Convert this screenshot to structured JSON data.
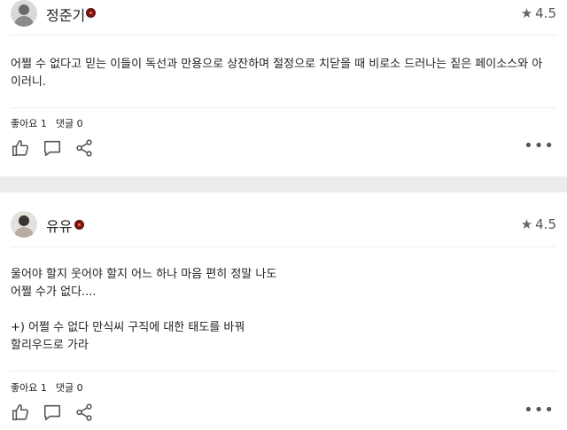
{
  "reviews": [
    {
      "author": "정준기",
      "rating": "4.5",
      "text": [
        "어쩔 수 없다고 믿는 이들이 독선과 만용으로 상잔하며 절정으로 치닫을 때 비로소 드러나는 짙은 페이소스와 아",
        "이러니."
      ],
      "likes_label": "좋아요 1",
      "comments_label": "댓글 0",
      "icons": {
        "like": "thumbs-up-icon",
        "comment": "comment-icon",
        "share": "share-icon",
        "more": "more-icon"
      }
    },
    {
      "author": "유유",
      "rating": "4.5",
      "text": [
        "울어야 할지 웃어야 할지 어느 하나 마음 편히 정말 나도",
        "어쩔 수가 없다....",
        "",
        "+) 어쩔 수 없다 만식씨 구직에 대한 태도를 바꿔",
        "할리우드로 가라"
      ],
      "likes_label": "좋아요 1",
      "comments_label": "댓글 0",
      "icons": {
        "like": "thumbs-up-icon",
        "comment": "comment-icon",
        "share": "share-icon",
        "more": "more-icon"
      }
    }
  ],
  "colors": {
    "badge": "#7a1614",
    "background": "#ececec",
    "card": "#ffffff"
  }
}
